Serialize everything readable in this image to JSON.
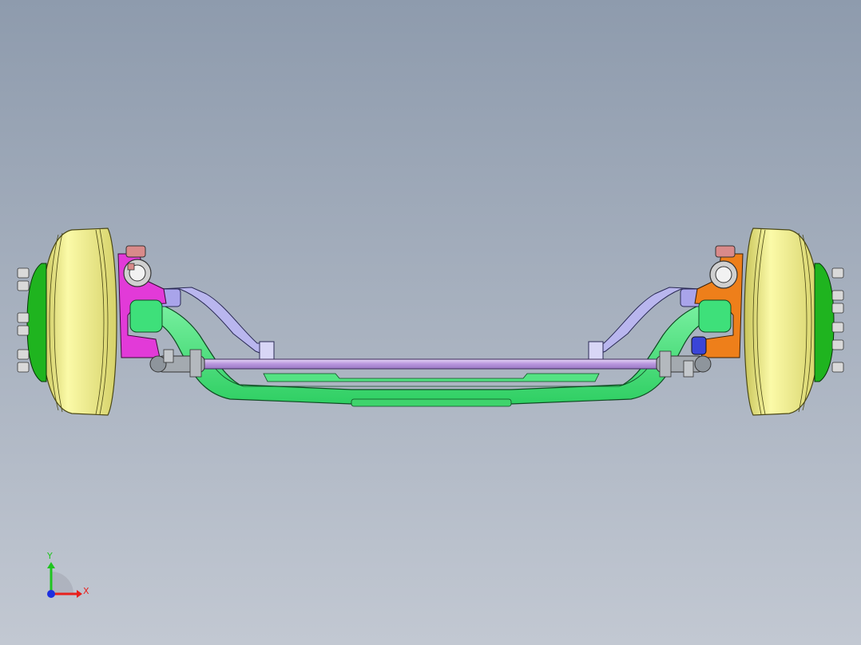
{
  "view": {
    "background_top": "#8e9bad",
    "background_bottom": "#c2c8d2"
  },
  "triad": {
    "x_label": "X",
    "y_label": "Y",
    "x_color": "#e8201c",
    "y_color": "#1fc41f",
    "z_color": "#1d2fe0"
  },
  "parts": {
    "brake_drum_color": "#f1f08a",
    "hub_color": "#1fb41f",
    "axle_beam_color": "#3ee07a",
    "tie_rod_color": "#c8a6e6",
    "steering_arm_color": "#b9b6ee",
    "knuckle_left_color": "#e23ad8",
    "knuckle_right_color": "#ee7f1a",
    "bolt_color": "#d9d9d9",
    "tie_rod_end_color": "#9aa0a6",
    "kingpin_cap_color": "#d98a8a"
  }
}
